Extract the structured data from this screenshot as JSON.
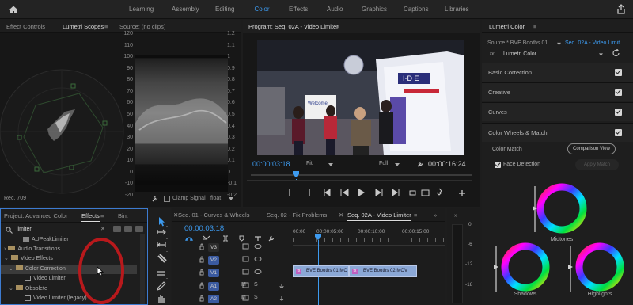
{
  "topbar": {
    "tabs": [
      "Learning",
      "Assembly",
      "Editing",
      "Color",
      "Effects",
      "Audio",
      "Graphics",
      "Captions",
      "Libraries"
    ],
    "active_tab": "Color",
    "accent": "#3d9bf0"
  },
  "scopes_panel": {
    "tabs": [
      "Effect Controls",
      "Lumetri Scopes",
      "Source: (no clips)"
    ],
    "active_tab": "Lumetri Scopes",
    "left_axis": [
      "120",
      "110",
      "100",
      "90",
      "80",
      "70",
      "60",
      "50",
      "40",
      "30",
      "20",
      "10",
      "0",
      "-10",
      "-20"
    ],
    "right_axis": [
      "1.2",
      "1.1",
      "1",
      "0.9",
      "0.8",
      "0.7",
      "0.6",
      "0.5",
      "0.4",
      "0.3",
      "0.2",
      "0.1",
      "0",
      "-0.1",
      "-0.2"
    ],
    "rec_label": "Rec. 709",
    "clamp_label": "Clamp Signal",
    "float_label": "float"
  },
  "program": {
    "title": "Program: Seq. 02A - Video Limiter",
    "timecode": "00:00:03:18",
    "fit": "Fit",
    "full": "Full",
    "duration": "00:00:16:24",
    "booth_text": "I·D E",
    "banner_text": "Welcome"
  },
  "lumetri": {
    "title": "Lumetri Color",
    "source": "Source * BVE Booths 01...",
    "sequence": "Seq. 02A - Video Limit...",
    "fx_label": "fx",
    "effect_name": "Lumetri Color",
    "sections": [
      "Basic Correction",
      "Creative",
      "Curves",
      "Color Wheels & Match"
    ],
    "color_match": "Color Match",
    "comparison_view": "Comparison View",
    "face_detection": "Face Detection",
    "apply_match": "Apply Match",
    "wheels": [
      "Midtones",
      "Shadows",
      "Highlights"
    ]
  },
  "effects_panel": {
    "tabs": [
      "Project: Advanced Color",
      "Effects",
      "Bin:"
    ],
    "active_tab": "Effects",
    "search_value": "limiter",
    "tree": [
      "AUPeakLimiter",
      "Audio Transitions",
      "Video Effects",
      "Color Correction",
      "Video Limiter",
      "Obsolete",
      "Video Limiter (legacy)"
    ]
  },
  "timeline": {
    "tabs": [
      "Seq. 01 - Curves & Wheels",
      "Seq. 02 - Fix Problems",
      "Seq. 02A - Video Limiter"
    ],
    "active_tab": "Seq. 02A - Video Limiter",
    "timecode": "00:00:03:18",
    "ruler": [
      "00:00",
      "00:00:05:00",
      "00:00:10:00",
      "00:00:15:00"
    ],
    "tracks": [
      "V3",
      "V2",
      "V1",
      "A1",
      "A2"
    ],
    "track_letters": [
      "M",
      "S"
    ],
    "clips": [
      "BVE Booths 01.MO",
      "BVE Booths 02.MOV"
    ]
  },
  "meter": {
    "labels": [
      "0",
      "-6",
      "-12",
      "-18"
    ]
  },
  "colors": {
    "accent": "#3d9bf0",
    "clip": "#8ba8d6",
    "active_border": "#3d7bd0",
    "annotation_circle": "#b8191c"
  }
}
